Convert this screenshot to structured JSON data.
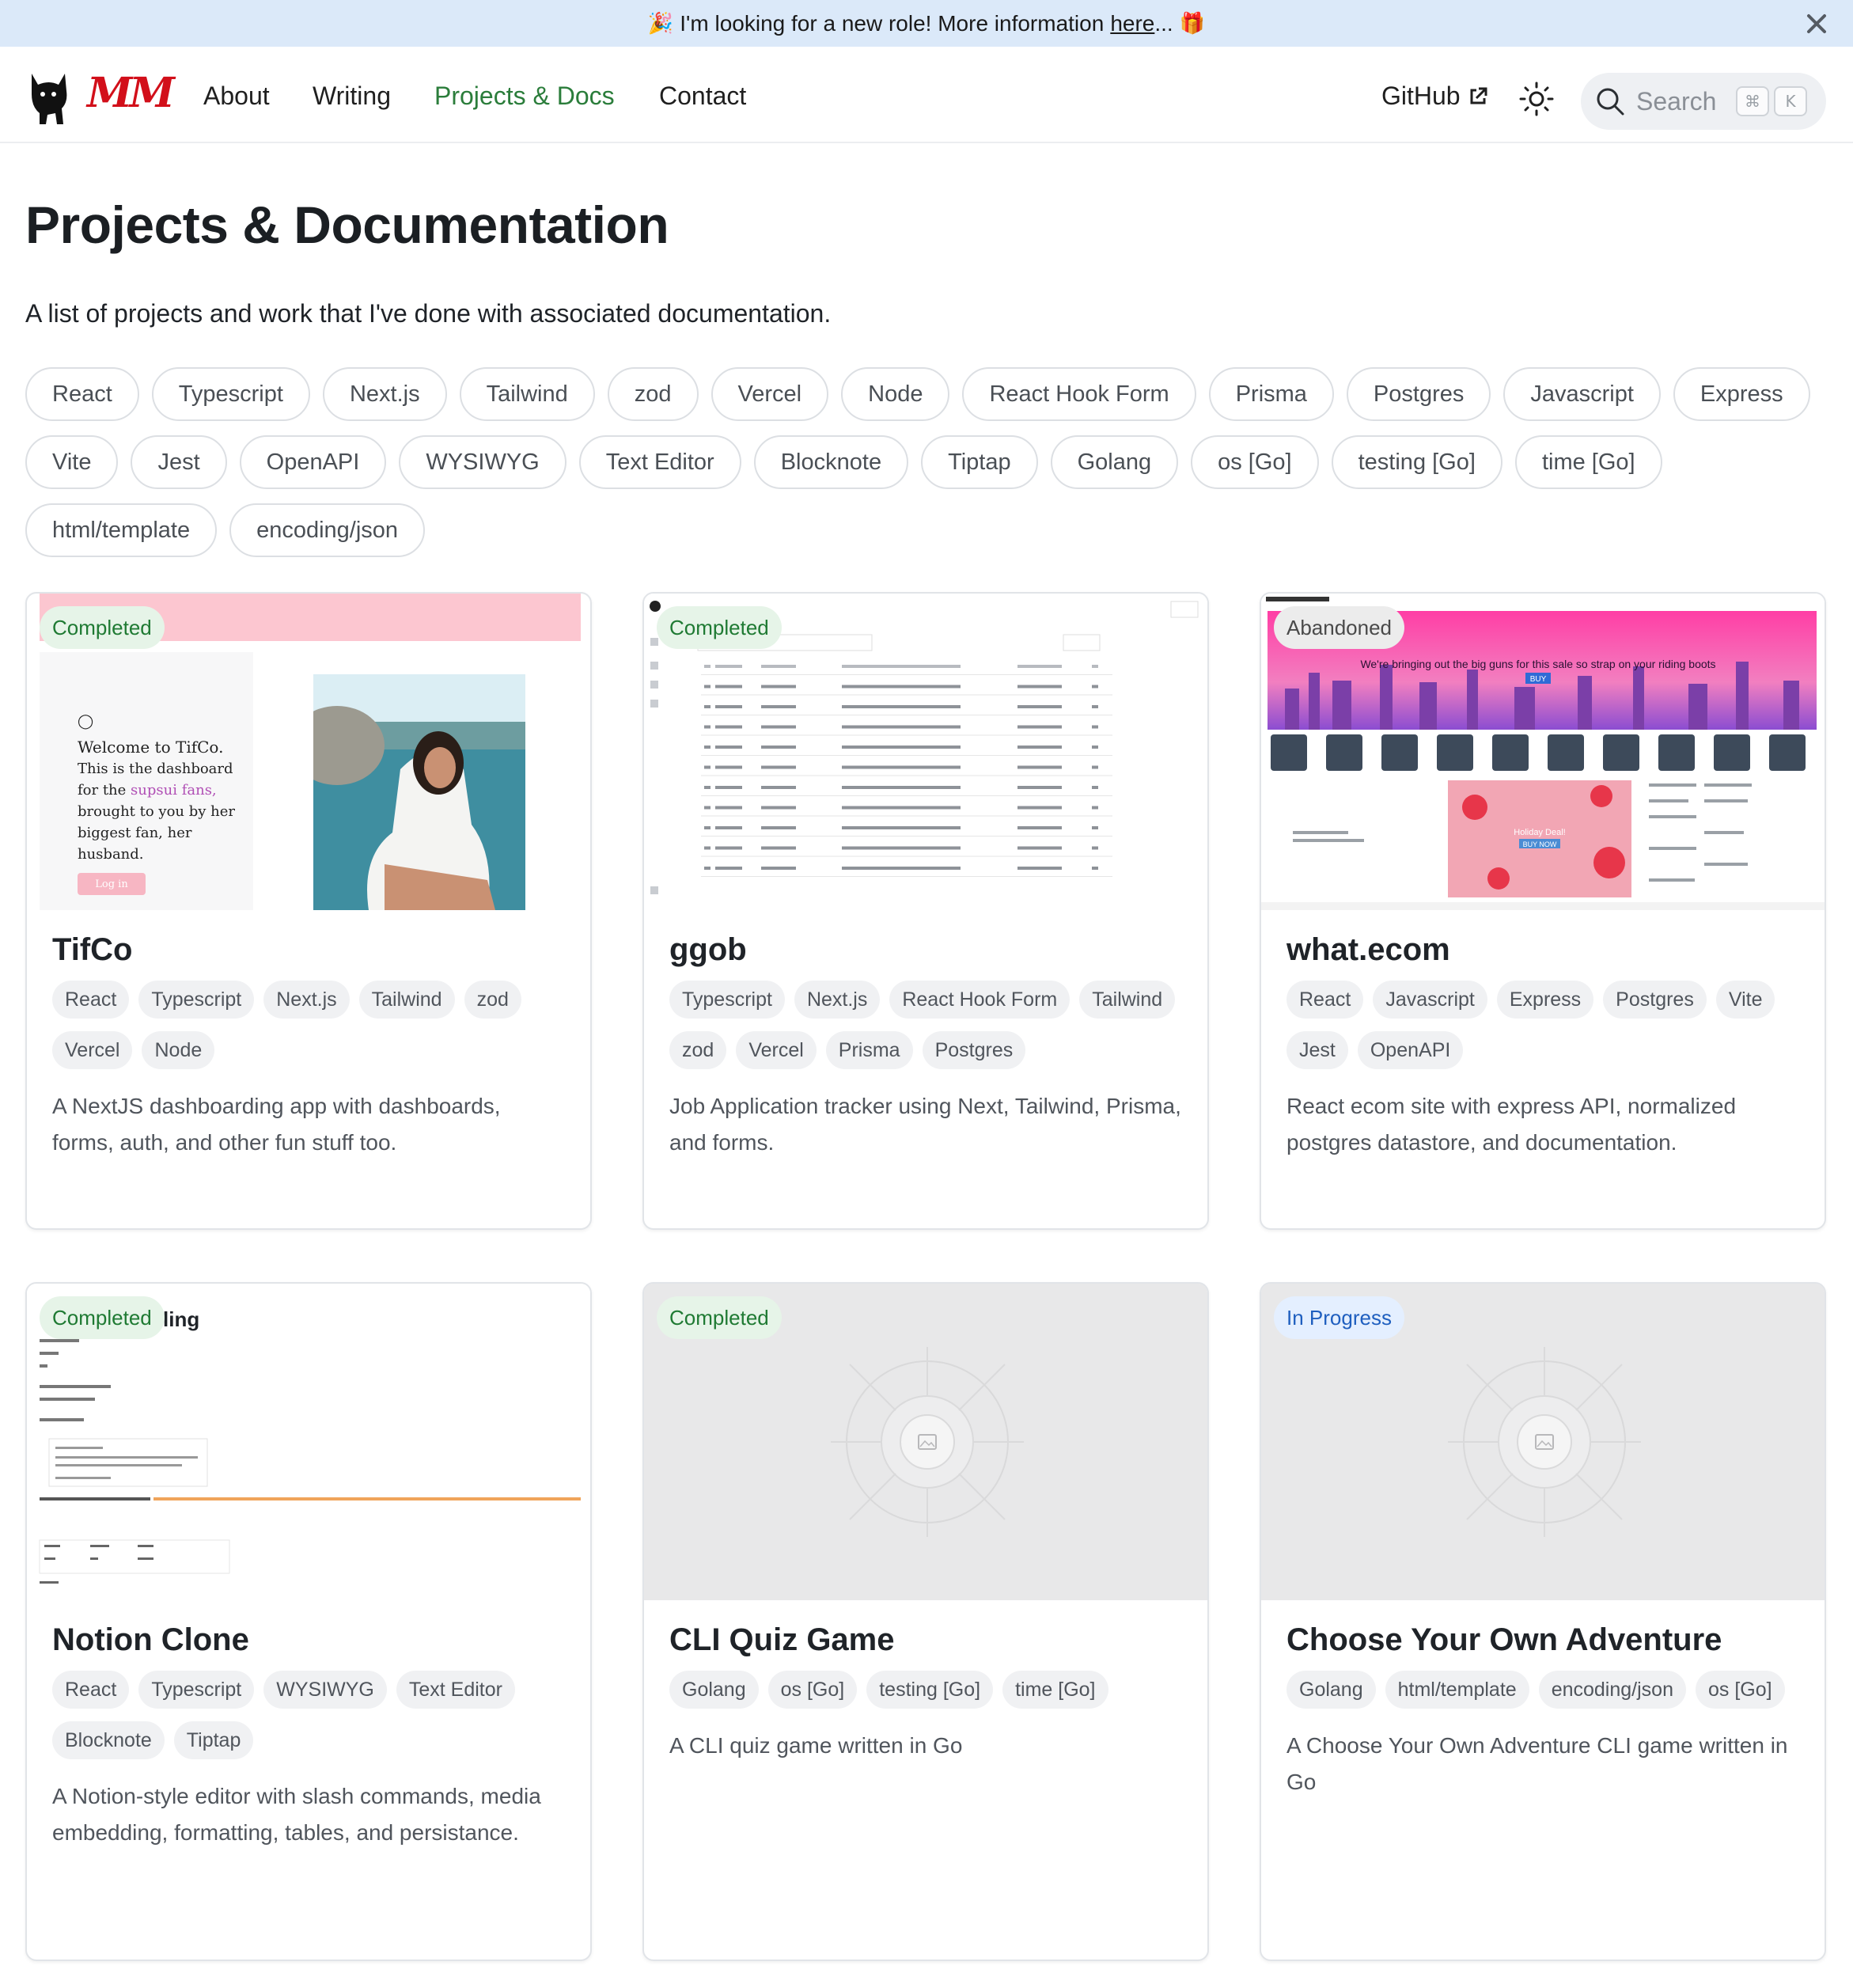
{
  "banner": {
    "text": "I'm looking for a new role! More information",
    "link": "here",
    "ellipsis": "...",
    "emoji_left": "🎉",
    "emoji_right": "🎁"
  },
  "nav": {
    "brand": "MM",
    "links": [
      "About",
      "Writing",
      "Projects & Docs",
      "Contact"
    ],
    "active": "Projects & Docs",
    "github": "GitHub",
    "search_placeholder": "Search",
    "kbd": [
      "⌘",
      "K"
    ]
  },
  "header": {
    "title": "Projects & Documentation",
    "description": "A list of projects and work that I've done with associated documentation."
  },
  "filters": [
    "React",
    "Typescript",
    "Next.js",
    "Tailwind",
    "zod",
    "Vercel",
    "Node",
    "React Hook Form",
    "Prisma",
    "Postgres",
    "Javascript",
    "Express",
    "Vite",
    "Jest",
    "OpenAPI",
    "WYSIWYG",
    "Text Editor",
    "Blocknote",
    "Tiptap",
    "Golang",
    "os [Go]",
    "testing [Go]",
    "time [Go]",
    "html/template",
    "encoding/json"
  ],
  "cards": [
    {
      "title": "TifCo",
      "status": "Completed",
      "tags": [
        "React",
        "Typescript",
        "Next.js",
        "Tailwind",
        "zod",
        "Vercel",
        "Node"
      ],
      "description": "A NextJS dashboarding app with dashboards, forms, auth, and other fun stuff too.",
      "preview_text": [
        "Welcome to TifCo.",
        "This is the dashboard",
        "for the",
        "supsui fans,",
        "brought to you by her",
        "biggest fan, her",
        "husband.",
        "Log in"
      ]
    },
    {
      "title": "ggob",
      "status": "Completed",
      "tags": [
        "Typescript",
        "Next.js",
        "React Hook Form",
        "Tailwind",
        "zod",
        "Vercel",
        "Prisma",
        "Postgres"
      ],
      "description": "Job Application tracker using Next, Tailwind, Prisma, and forms."
    },
    {
      "title": "what.ecom",
      "status": "Abandoned",
      "tags": [
        "React",
        "Javascript",
        "Express",
        "Postgres",
        "Vite",
        "Jest",
        "OpenAPI"
      ],
      "description": "React ecom site with express API, normalized postgres datastore, and documentation.",
      "preview_text": [
        "We're bringing out the big guns for this sale so strap on your riding boots",
        "BUY",
        "Holiday Deal!",
        "BUY NOW"
      ]
    },
    {
      "title": "Notion Clone",
      "status": "Completed",
      "tags": [
        "React",
        "Typescript",
        "WYSIWYG",
        "Text Editor",
        "Blocknote",
        "Tiptap"
      ],
      "description": "A Notion-style editor with slash commands, media embedding, formatting, tables, and persistance.",
      "preview_text": [
        "ling"
      ]
    },
    {
      "title": "CLI Quiz Game",
      "status": "Completed",
      "tags": [
        "Golang",
        "os [Go]",
        "testing [Go]",
        "time [Go]"
      ],
      "description": "A CLI quiz game written in Go"
    },
    {
      "title": "Choose Your Own Adventure",
      "status": "In Progress",
      "tags": [
        "Golang",
        "html/template",
        "encoding/json",
        "os [Go]"
      ],
      "description": "A Choose Your Own Adventure CLI game written in Go"
    }
  ]
}
